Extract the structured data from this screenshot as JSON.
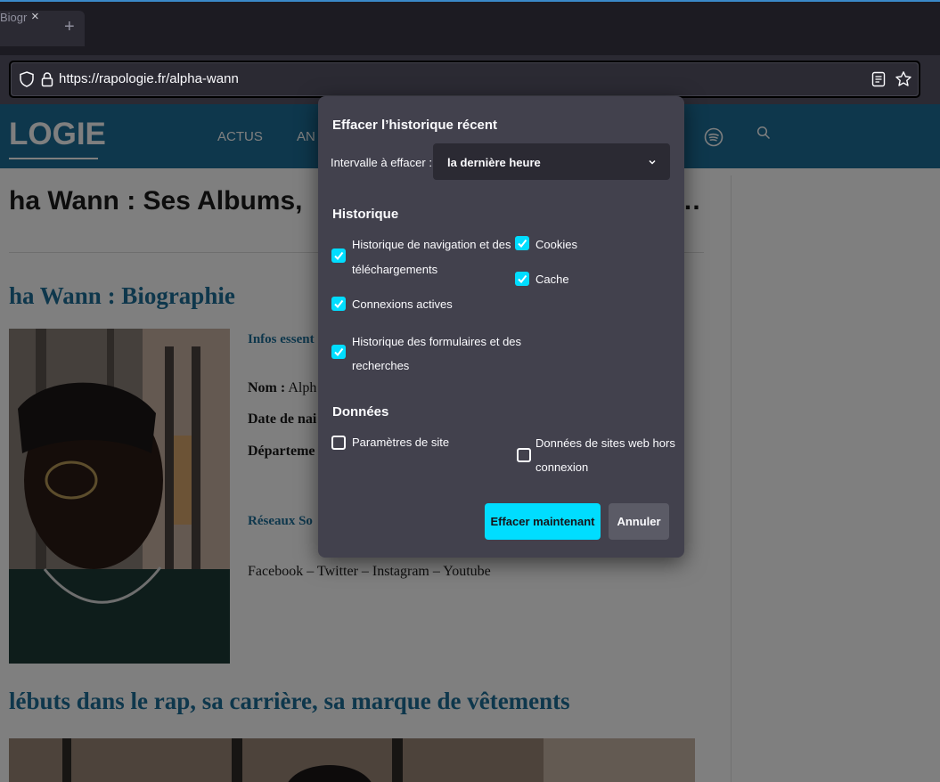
{
  "tab": {
    "title": "Biogr",
    "close_glyph": "×",
    "newtab_glyph": "+"
  },
  "urlbar": {
    "url": "https://rapologie.fr/alpha-wann"
  },
  "site": {
    "logo": "LOGIE",
    "nav": [
      "ACTUS",
      "AN"
    ],
    "page_title": "ha Wann : Ses Albums,",
    "title_ellipsis": "…",
    "bio_heading": "ha Wann : Biographie",
    "infos_heading": "Infos essent",
    "nom_label": "Nom :",
    "nom_value": " Alph",
    "date_label": "Date de nai",
    "dept_label": "Départeme",
    "reseaux_heading": "Réseaux So",
    "socials": "Facebook – Twitter – Instagram – Youtube",
    "debuts_heading": "lébuts dans le rap, sa carrière, sa marque de vêtements"
  },
  "dialog": {
    "title": "Effacer l’historique récent",
    "interval_label": "Intervalle à effacer :",
    "interval_value": "la dernière heure",
    "history_heading": "Historique",
    "history_items": [
      {
        "label_line1": "Historique de navigation et des",
        "label_line2": "téléchargements",
        "checked": true
      },
      {
        "label": "Cookies",
        "checked": true
      },
      {
        "label": "Cache",
        "checked": true
      },
      {
        "label": "Connexions actives",
        "checked": true
      },
      {
        "label_line1": "Historique des formulaires et des",
        "label_line2": "recherches",
        "checked": true
      }
    ],
    "data_heading": "Données",
    "data_items": [
      {
        "label": "Paramètres de site",
        "checked": false
      },
      {
        "label_line1": "Données de sites web hors",
        "label_line2": "connexion",
        "checked": false
      }
    ],
    "clear_button": "Effacer maintenant",
    "cancel_button": "Annuler"
  },
  "colors": {
    "accent": "#00ddff",
    "dialog_bg": "#42414d",
    "site_header": "#1d6f99",
    "chrome_bg": "#1c1b22"
  },
  "icons": [
    "shield-icon",
    "lock-icon",
    "reader-view-icon",
    "bookmark-star-icon",
    "spotify-icon",
    "search-icon",
    "chevron-down-icon",
    "checkmark-icon"
  ]
}
